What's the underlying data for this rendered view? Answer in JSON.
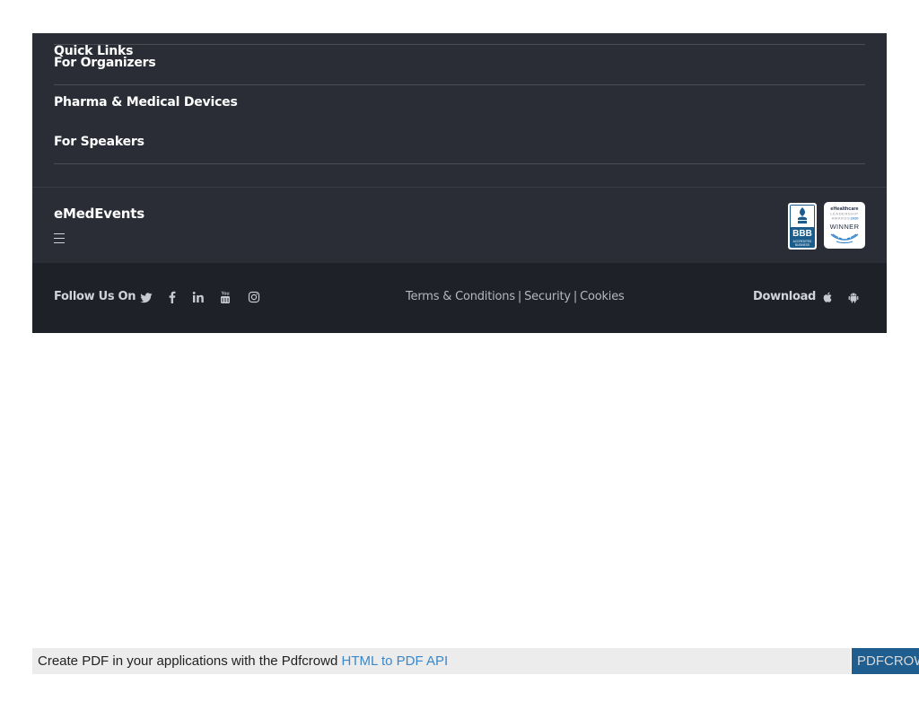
{
  "quick_links": {
    "heading": "Quick Links",
    "items": [
      {
        "label": "For Organizers"
      },
      {
        "label": "Pharma & Medical Devices"
      },
      {
        "label": "For Speakers"
      }
    ]
  },
  "brand": {
    "name": "eMedEvents",
    "menu_icon": "hamburger-menu-icon"
  },
  "badges": {
    "bbb": {
      "title": "BBB",
      "line1": "ACCREDITED",
      "line2": "BUSINESS"
    },
    "ehealthcare": {
      "title": "eHealthcare",
      "line1": "LEADERSHIP",
      "line2": "AWARDS",
      "year": "2020",
      "status": "WINNER"
    }
  },
  "footer": {
    "follow_label": "Follow Us On",
    "social": [
      {
        "name": "twitter-icon"
      },
      {
        "name": "facebook-icon"
      },
      {
        "name": "linkedin-icon"
      },
      {
        "name": "youtube-icon"
      },
      {
        "name": "instagram-icon"
      }
    ],
    "legal": {
      "terms": "Terms & Conditions",
      "separator": "|",
      "security": "Security",
      "cookies": "Cookies"
    },
    "download_label": "Download",
    "apps": [
      {
        "name": "apple-icon"
      },
      {
        "name": "android-icon"
      }
    ]
  },
  "pdf_banner": {
    "text": "Create PDF in your applications with the Pdfcrowd",
    "link": "HTML to PDF API",
    "brand": "PDFCROWD"
  },
  "colors": {
    "footer_bg": "#2a2d35",
    "footer_bottom_bg": "#1f2128",
    "bbb_blue": "#1a5c8c",
    "pdf_link": "#3b87c8"
  }
}
